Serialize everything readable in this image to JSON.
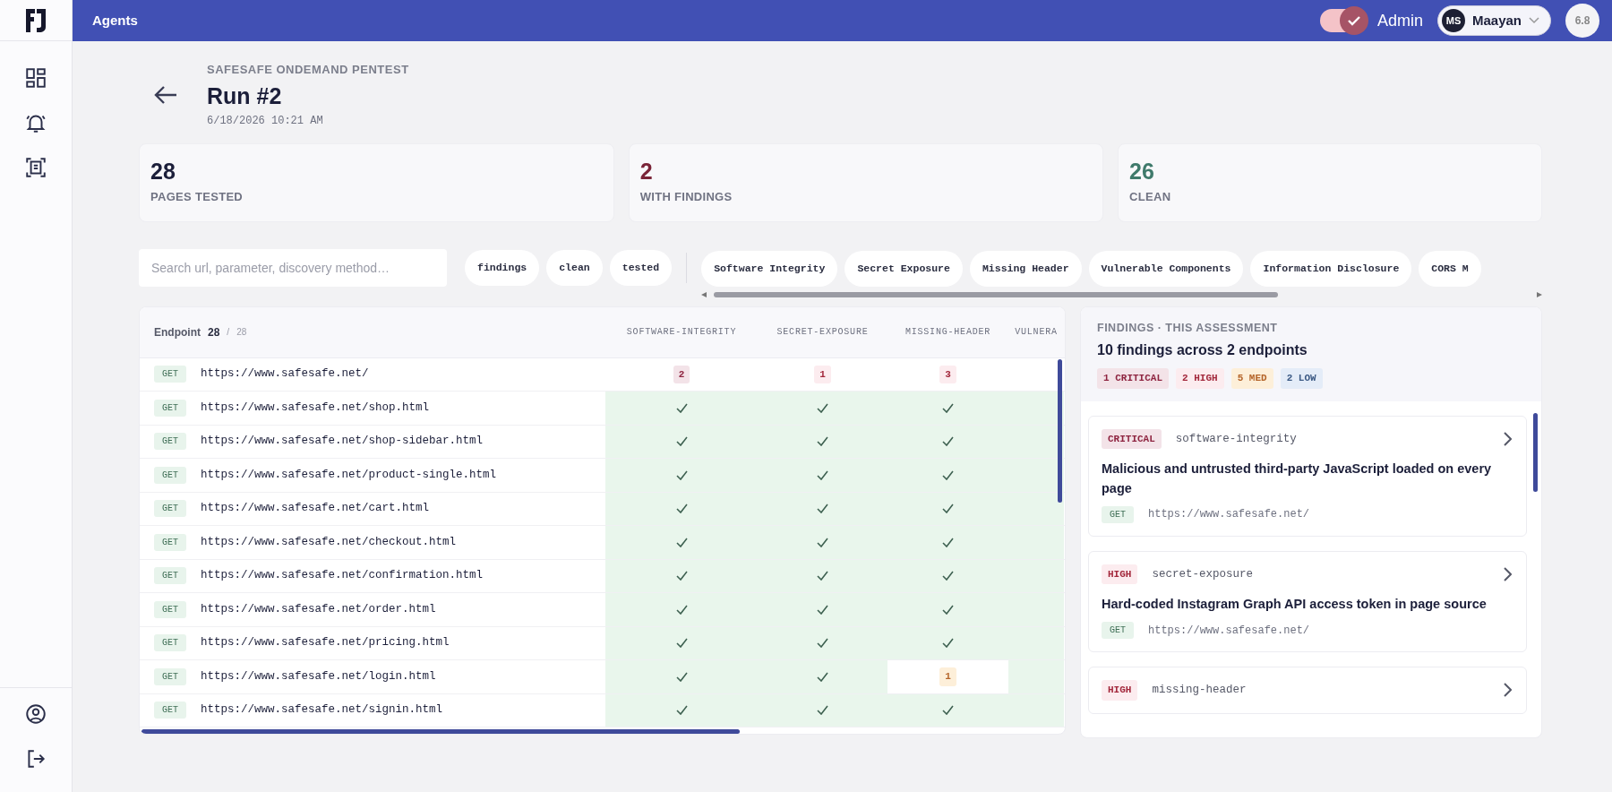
{
  "topbar": {
    "title": "Agents",
    "admin_toggle": {
      "label": "Admin",
      "on": true
    },
    "user": {
      "initials": "MS",
      "name": "Maayan"
    },
    "score": "6.8"
  },
  "header": {
    "eyebrow": "SAFESAFE ONDEMAND PENTEST",
    "title": "Run #2",
    "timestamp": "6/18/2026 10:21 AM"
  },
  "stats": [
    {
      "value": "28",
      "label": "PAGES TESTED",
      "color": "#1c1f3a"
    },
    {
      "value": "2",
      "label": "WITH FINDINGS",
      "color": "#7a2438"
    },
    {
      "value": "26",
      "label": "CLEAN",
      "color": "#3f7a6b"
    }
  ],
  "filters": {
    "search_placeholder": "Search url, parameter, discovery method…",
    "status_chips": [
      "findings",
      "clean",
      "tested"
    ],
    "category_chips": [
      "Software Integrity",
      "Secret Exposure",
      "Missing Header",
      "Vulnerable Components",
      "Information Disclosure",
      "CORS M"
    ]
  },
  "table": {
    "endpoint_label": "Endpoint",
    "count": "28",
    "separator": "/",
    "total": "28",
    "columns": [
      "SOFTWARE-INTEGRITY",
      "SECRET-EXPOSURE",
      "MISSING-HEADER",
      "VULNERA"
    ],
    "rows": [
      {
        "method": "GET",
        "url": "https://www.safesafe.net/",
        "cells": [
          {
            "kind": "count_critical",
            "value": "2"
          },
          {
            "kind": "count_high",
            "value": "1"
          },
          {
            "kind": "count_high",
            "value": "3"
          },
          {
            "kind": "empty"
          }
        ]
      },
      {
        "method": "GET",
        "url": "https://www.safesafe.net/shop.html",
        "cells": [
          {
            "kind": "clean",
            "check": true
          },
          {
            "kind": "clean",
            "check": true
          },
          {
            "kind": "clean",
            "check": true
          },
          {
            "kind": "clean",
            "check": false
          }
        ]
      },
      {
        "method": "GET",
        "url": "https://www.safesafe.net/shop-sidebar.html",
        "cells": [
          {
            "kind": "clean",
            "check": true
          },
          {
            "kind": "clean",
            "check": true
          },
          {
            "kind": "clean",
            "check": true
          },
          {
            "kind": "clean",
            "check": false
          }
        ]
      },
      {
        "method": "GET",
        "url": "https://www.safesafe.net/product-single.html",
        "cells": [
          {
            "kind": "clean",
            "check": true
          },
          {
            "kind": "clean",
            "check": true
          },
          {
            "kind": "clean",
            "check": true
          },
          {
            "kind": "clean",
            "check": false
          }
        ]
      },
      {
        "method": "GET",
        "url": "https://www.safesafe.net/cart.html",
        "cells": [
          {
            "kind": "clean",
            "check": true
          },
          {
            "kind": "clean",
            "check": true
          },
          {
            "kind": "clean",
            "check": true
          },
          {
            "kind": "clean",
            "check": false
          }
        ]
      },
      {
        "method": "GET",
        "url": "https://www.safesafe.net/checkout.html",
        "cells": [
          {
            "kind": "clean",
            "check": true
          },
          {
            "kind": "clean",
            "check": true
          },
          {
            "kind": "clean",
            "check": true
          },
          {
            "kind": "clean",
            "check": false
          }
        ]
      },
      {
        "method": "GET",
        "url": "https://www.safesafe.net/confirmation.html",
        "cells": [
          {
            "kind": "clean",
            "check": true
          },
          {
            "kind": "clean",
            "check": true
          },
          {
            "kind": "clean",
            "check": true
          },
          {
            "kind": "clean",
            "check": false
          }
        ]
      },
      {
        "method": "GET",
        "url": "https://www.safesafe.net/order.html",
        "cells": [
          {
            "kind": "clean",
            "check": true
          },
          {
            "kind": "clean",
            "check": true
          },
          {
            "kind": "clean",
            "check": true
          },
          {
            "kind": "clean",
            "check": false
          }
        ]
      },
      {
        "method": "GET",
        "url": "https://www.safesafe.net/pricing.html",
        "cells": [
          {
            "kind": "clean",
            "check": true
          },
          {
            "kind": "clean",
            "check": true
          },
          {
            "kind": "clean",
            "check": true
          },
          {
            "kind": "clean",
            "check": false
          }
        ]
      },
      {
        "method": "GET",
        "url": "https://www.safesafe.net/login.html",
        "cells": [
          {
            "kind": "clean",
            "check": true
          },
          {
            "kind": "clean",
            "check": true
          },
          {
            "kind": "count_medium",
            "value": "1"
          },
          {
            "kind": "clean",
            "check": false
          }
        ]
      },
      {
        "method": "GET",
        "url": "https://www.safesafe.net/signin.html",
        "cells": [
          {
            "kind": "clean",
            "check": true
          },
          {
            "kind": "clean",
            "check": true
          },
          {
            "kind": "clean",
            "check": true
          },
          {
            "kind": "clean",
            "check": false
          }
        ]
      }
    ]
  },
  "findings_panel": {
    "eyebrow": "FINDINGS · THIS ASSESSMENT",
    "title": "10 findings across 2 endpoints",
    "summary": [
      {
        "text": "1 CRITICAL",
        "kind": "critical"
      },
      {
        "text": "2 HIGH",
        "kind": "high"
      },
      {
        "text": "5 MED",
        "kind": "medium"
      },
      {
        "text": "2 LOW",
        "kind": "low"
      }
    ],
    "findings": [
      {
        "kind": "critical",
        "severity_label": "CRITICAL",
        "category": "software-integrity",
        "title": "Malicious and untrusted third-party JavaScript loaded on every page",
        "method": "GET",
        "url": "https://www.safesafe.net/"
      },
      {
        "kind": "high",
        "severity_label": "HIGH",
        "category": "secret-exposure",
        "title": "Hard-coded Instagram Graph API access token in page source",
        "method": "GET",
        "url": "https://www.safesafe.net/"
      },
      {
        "kind": "high",
        "severity_label": "HIGH",
        "category": "missing-header"
      }
    ]
  }
}
